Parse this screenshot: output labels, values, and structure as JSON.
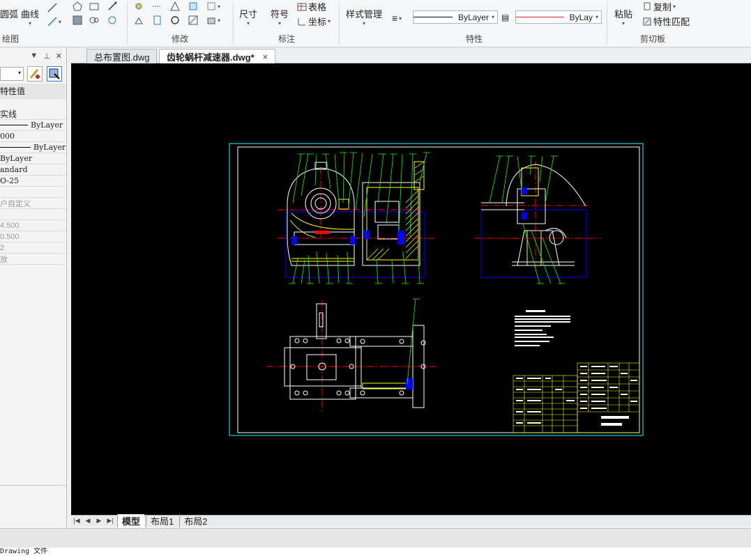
{
  "ribbon": {
    "draw_panel": {
      "label": "绘图",
      "arc": "圆弧",
      "curve": "曲线"
    },
    "modify_panel": {
      "label": "修改"
    },
    "annotate_panel": {
      "label": "标注",
      "dimension": "尺寸",
      "symbol": "符号",
      "table": "表格",
      "coordinate": "坐标"
    },
    "style_manage": "样式管理",
    "properties_panel": {
      "label": "特性",
      "linetype_value": "ByLayer",
      "color_value": "ByLay"
    },
    "clipboard_panel": {
      "label": "剪切板",
      "paste": "粘贴",
      "copy": "复制",
      "match_props": "特性匹配"
    }
  },
  "properties": {
    "header_col": "特性值",
    "rows": [
      "实线",
      "ByLayer",
      "000",
      "ByLayer",
      "ByLayer",
      "andard",
      "O-25",
      "",
      "户自定义",
      "",
      "4.500",
      "0.500",
      "2",
      "放"
    ]
  },
  "tabs": [
    {
      "label": "总布置图.dwg",
      "active": false
    },
    {
      "label": "齿轮蜗杆减速器.dwg*",
      "active": true
    }
  ],
  "tab_close": "×",
  "layout_tabs": [
    {
      "label": "模型",
      "active": true
    },
    {
      "label": "布局1",
      "active": false
    },
    {
      "label": "布局2",
      "active": false
    }
  ],
  "status_text": "Drawing 文件",
  "colors": {
    "canvas": "#000000",
    "frame": "#00ffff",
    "lines": "#ffffff",
    "leaders": "#00ff00",
    "center": "#ff0000",
    "outline": "#0000ff",
    "hatch": "#ffff00"
  }
}
